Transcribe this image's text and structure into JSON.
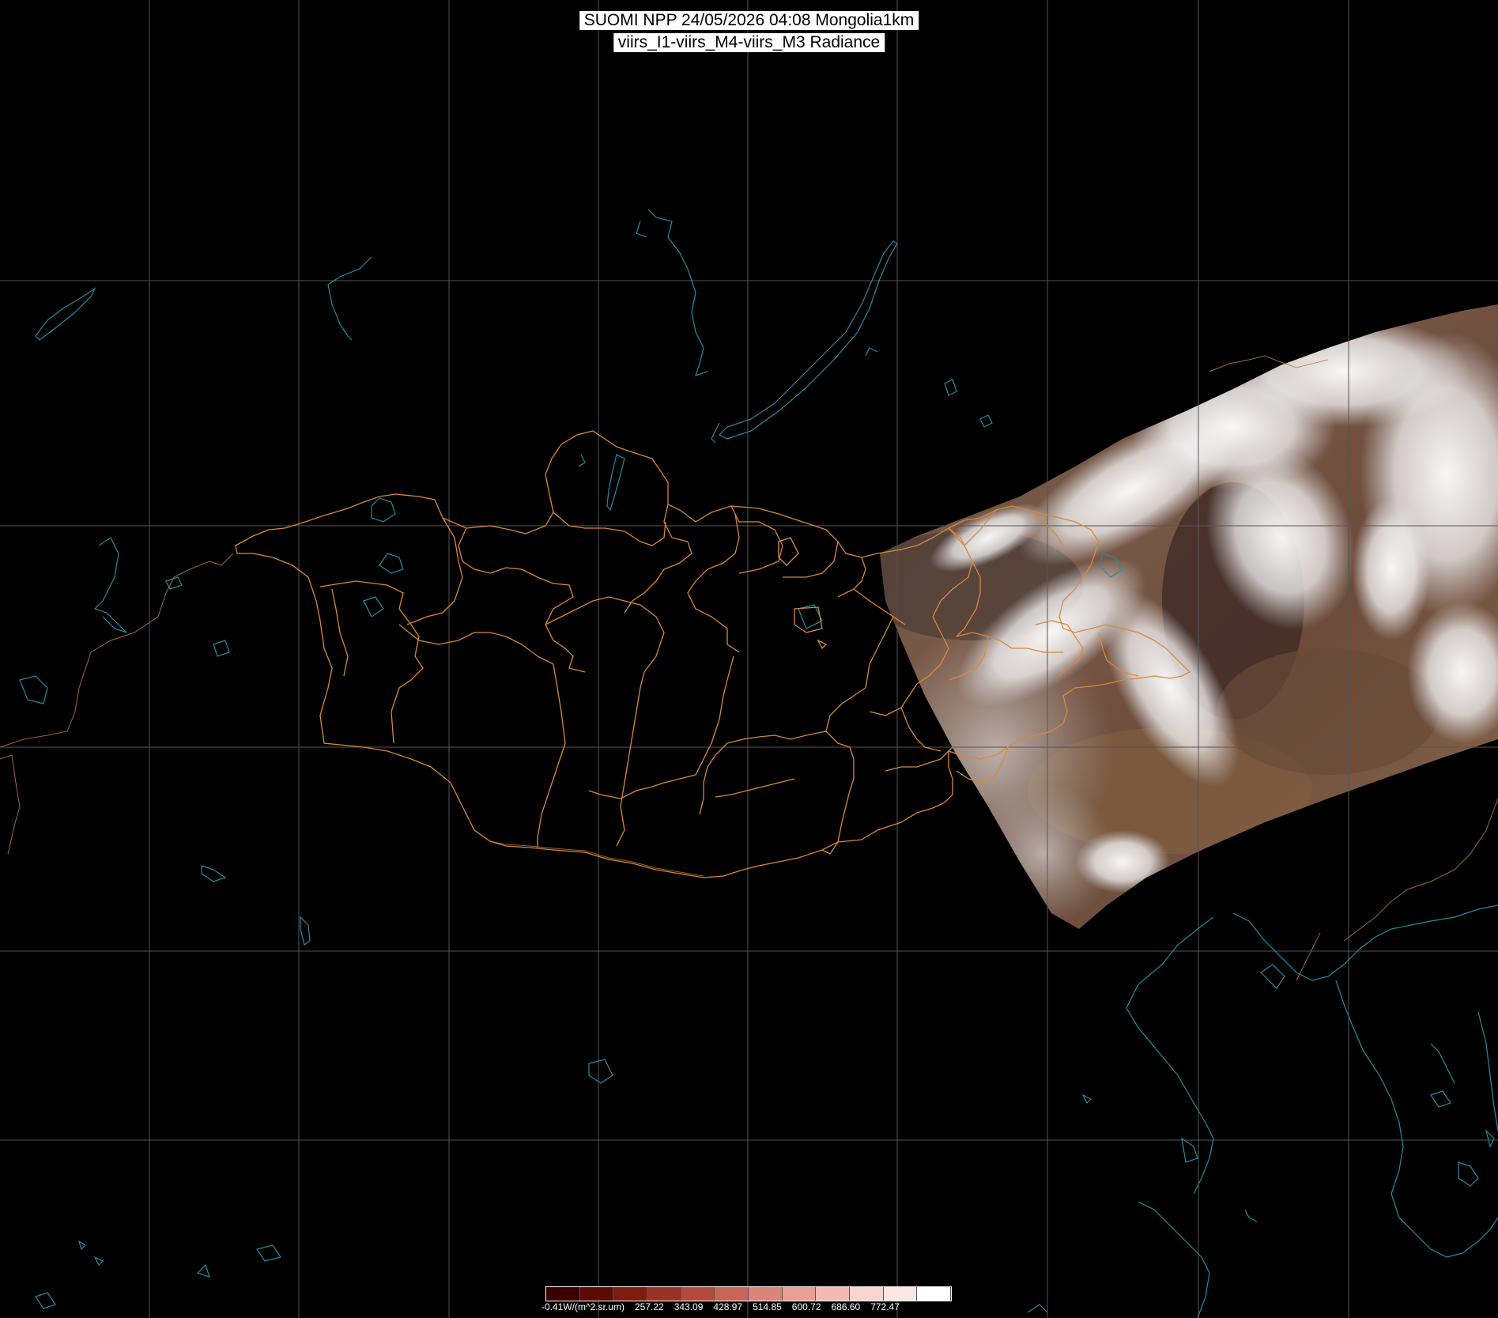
{
  "title": {
    "line1": "SUOMI NPP 24/05/2026 04:08 Mongolia1km",
    "line2": "viirs_I1-viirs_M4-viirs_M3 Radiance"
  },
  "colors": {
    "background": "#000000",
    "graticule": "#555555",
    "coastline": "#2a8aa0",
    "admin_boundary": "#d8893a",
    "country_boundary": "#b87a3a"
  },
  "colorbar": {
    "swatches": [
      "#3a0000",
      "#5c0a05",
      "#7d1c0f",
      "#9a3224",
      "#b54a3c",
      "#c96558",
      "#dc8478",
      "#e89f95",
      "#f2bab2",
      "#f8d4cf",
      "#fbe6e3",
      "#ffffff"
    ],
    "labels": [
      "-0.41W/(m^2.sr.um)",
      "257.22",
      "343.09",
      "428.97",
      "514.85",
      "600.72",
      "686.60",
      "772.47"
    ]
  }
}
